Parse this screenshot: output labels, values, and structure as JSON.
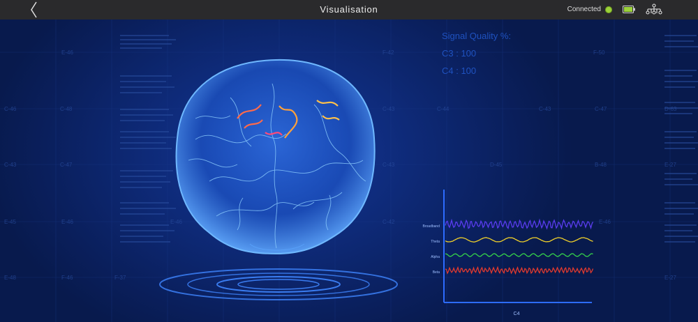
{
  "topbar": {
    "title": "Visualisation",
    "connection_status": "Connected",
    "back_icon": "chevron-left-icon",
    "battery_icon": "battery-icon",
    "network_icon": "network-tree-icon",
    "status_color": "#9bd23a"
  },
  "signal_quality": {
    "title": "Signal Quality %:",
    "channels": [
      {
        "label": "C3 : 100"
      },
      {
        "label": "C4 : 100"
      }
    ]
  },
  "eeg_panel": {
    "channel": "C4",
    "bands": [
      {
        "name": "Broadband",
        "color": "#5a3cf0"
      },
      {
        "name": "Theta",
        "color": "#f0d02a"
      },
      {
        "name": "Alpha",
        "color": "#35d24a"
      },
      {
        "name": "Beta",
        "color": "#e23a2e"
      }
    ]
  },
  "grid_labels": {
    "rows": [
      [
        "E-46",
        "F-42",
        "F-50"
      ],
      [
        "C-46",
        "C-48",
        "C-43",
        "C-44",
        "C-43",
        "C-47",
        "D-63"
      ],
      [
        "C-43",
        "C-47",
        "C-43",
        "D-45",
        "B-48",
        "E-27"
      ],
      [
        "E-45",
        "E-46",
        "E-46",
        "C-42",
        "E-46"
      ],
      [
        "E-48",
        "F-46",
        "F-37",
        "E-27"
      ]
    ]
  },
  "colors": {
    "accent": "#1f52c0",
    "background": "#0a1d52"
  }
}
